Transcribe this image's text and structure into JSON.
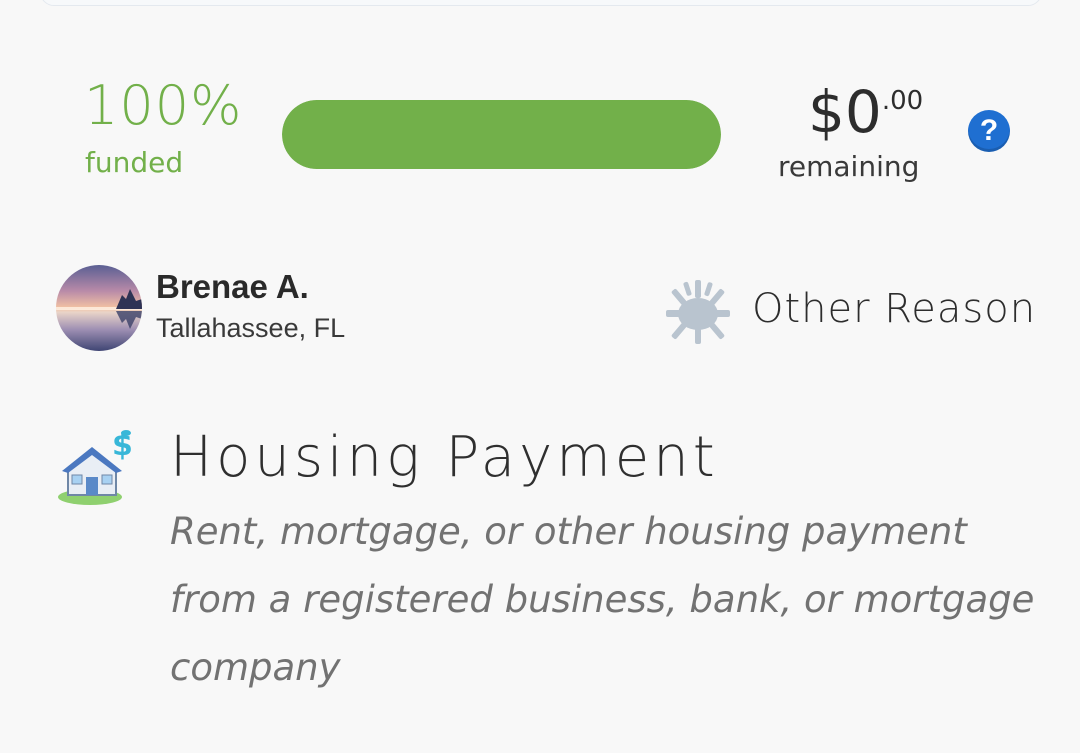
{
  "funding": {
    "percent_text": "100%",
    "percent_value": 100,
    "funded_label": "funded",
    "amount_dollars": "$0",
    "amount_cents": ".00",
    "remaining_label": "remaining",
    "help_glyph": "?",
    "accent_color": "#72b04a"
  },
  "user": {
    "name": "Brenae A.",
    "location": "Tallahassee, FL",
    "avatar_icon": "lake-sunset-avatar"
  },
  "reason": {
    "icon": "sunburst-icon",
    "label": "Other Reason"
  },
  "category": {
    "icon": "house-dollar-icon",
    "title": "Housing Payment",
    "description": "Rent, mortgage, or other housing payment from a registered business, bank, or mortgage company"
  }
}
